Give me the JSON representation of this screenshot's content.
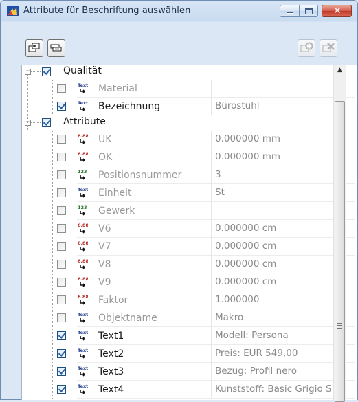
{
  "window": {
    "title": "Attribute für Beschriftung auswählen",
    "min_label": "–",
    "max_label": "□",
    "close_label": "✕"
  },
  "toolbar": {
    "buttons": [
      {
        "icon": "expand-all-icon",
        "enabled": true
      },
      {
        "icon": "collapse-all-icon",
        "enabled": true
      },
      {
        "icon": "add-attribute-icon",
        "enabled": false
      },
      {
        "icon": "remove-attribute-icon",
        "enabled": false
      }
    ]
  },
  "tree": {
    "groups": [
      {
        "label": "Qualität",
        "checked": true,
        "expanded": true,
        "items": [
          {
            "label": "Material",
            "value": "",
            "checked": false,
            "type": "text"
          },
          {
            "label": "Bezeichnung",
            "value": "Bürostuhl",
            "checked": true,
            "type": "text"
          }
        ]
      },
      {
        "label": "Attribute",
        "checked": true,
        "expanded": true,
        "items": [
          {
            "label": "UK",
            "value": "0.000000 mm",
            "checked": false,
            "type": "number"
          },
          {
            "label": "OK",
            "value": "0.000000 mm",
            "checked": false,
            "type": "number"
          },
          {
            "label": "Positionsnummer",
            "value": "3",
            "checked": false,
            "type": "integer"
          },
          {
            "label": "Einheit",
            "value": "St",
            "checked": false,
            "type": "text"
          },
          {
            "label": "Gewerk",
            "value": "",
            "checked": false,
            "type": "integer"
          },
          {
            "label": "V6",
            "value": "0.000000 cm",
            "checked": false,
            "type": "number"
          },
          {
            "label": "V7",
            "value": "0.000000 cm",
            "checked": false,
            "type": "number"
          },
          {
            "label": "V8",
            "value": "0.000000 cm",
            "checked": false,
            "type": "number"
          },
          {
            "label": "V9",
            "value": "0.000000 cm",
            "checked": false,
            "type": "number"
          },
          {
            "label": "Faktor",
            "value": "1.000000",
            "checked": false,
            "type": "number"
          },
          {
            "label": "Objektname",
            "value": "Makro",
            "checked": false,
            "type": "text"
          },
          {
            "label": "Text1",
            "value": "Modell: Persona",
            "checked": true,
            "type": "text"
          },
          {
            "label": "Text2",
            "value": "Preis: EUR 549,00",
            "checked": true,
            "type": "text"
          },
          {
            "label": "Text3",
            "value": "Bezug: Profil nero",
            "checked": true,
            "type": "text"
          },
          {
            "label": "Text4",
            "value": "Kunststoff: Basic Grigio S",
            "checked": true,
            "type": "text"
          }
        ]
      }
    ],
    "type_icons": {
      "text": {
        "glyph": "Text",
        "color": "#1e3a8a"
      },
      "number": {
        "glyph": "6.88",
        "color": "#b3261e"
      },
      "integer": {
        "glyph": "123",
        "color": "#2e7d32"
      }
    }
  },
  "colors": {
    "chrome": "#dbe7f5",
    "close_button": "#c0392b",
    "checkmark": "#2a5fa0"
  }
}
